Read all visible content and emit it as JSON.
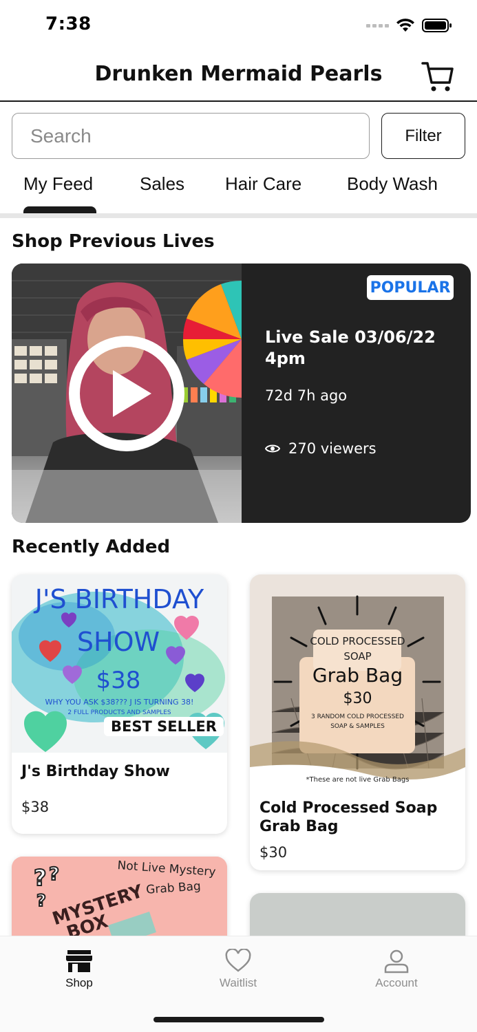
{
  "status_bar": {
    "time": "7:38"
  },
  "header": {
    "title": "Drunken Mermaid Pearls",
    "cart_icon": "cart-icon"
  },
  "search": {
    "placeholder": "Search",
    "value": ""
  },
  "filter": {
    "label": "Filter"
  },
  "tabs": [
    {
      "label": "My Feed",
      "active": true
    },
    {
      "label": "Sales",
      "active": false
    },
    {
      "label": "Hair Care",
      "active": false
    },
    {
      "label": "Body Wash",
      "active": false
    }
  ],
  "sections": {
    "previous_lives": "Shop Previous Lives",
    "recently_added": "Recently Added"
  },
  "live_card": {
    "badge": "POPULAR",
    "title": "Live Sale 03/06/22 4pm",
    "ago": "72d 7h ago",
    "viewers": "270 viewers",
    "badge_color": "#1a73e8",
    "background": "#222222"
  },
  "products": [
    {
      "name": "J's Birthday Show",
      "price": "$38",
      "badge": "BEST SELLER",
      "image_text": {
        "line1": "J'S BIRTHDAY",
        "line2": "SHOW",
        "line3": "$38",
        "line4": "WHY YOU ASK $38??? J IS TURNING 38!",
        "line5": "2 FULL PRODUCTS AND SAMPLES"
      }
    },
    {
      "name": "Cold Processed Soap Grab Bag",
      "price": "$30",
      "image_text": {
        "line1": "COLD PROCESSED",
        "line2": "SOAP",
        "line3": "Grab Bag",
        "line4": "$30",
        "line5": "3 RANDOM COLD PROCESSED",
        "line6": "SOAP & SAMPLES",
        "footer": "*These are not live Grab Bags"
      }
    },
    {
      "image_text": {
        "line1": "Not Live Mystery",
        "line2": "Grab Bag",
        "line3": "MYSTERY",
        "line4": "BOX"
      }
    },
    {}
  ],
  "bottom_nav": [
    {
      "label": "Shop",
      "icon": "store-icon",
      "active": true
    },
    {
      "label": "Waitlist",
      "icon": "heart-icon",
      "active": false
    },
    {
      "label": "Account",
      "icon": "person-icon",
      "active": false
    }
  ]
}
